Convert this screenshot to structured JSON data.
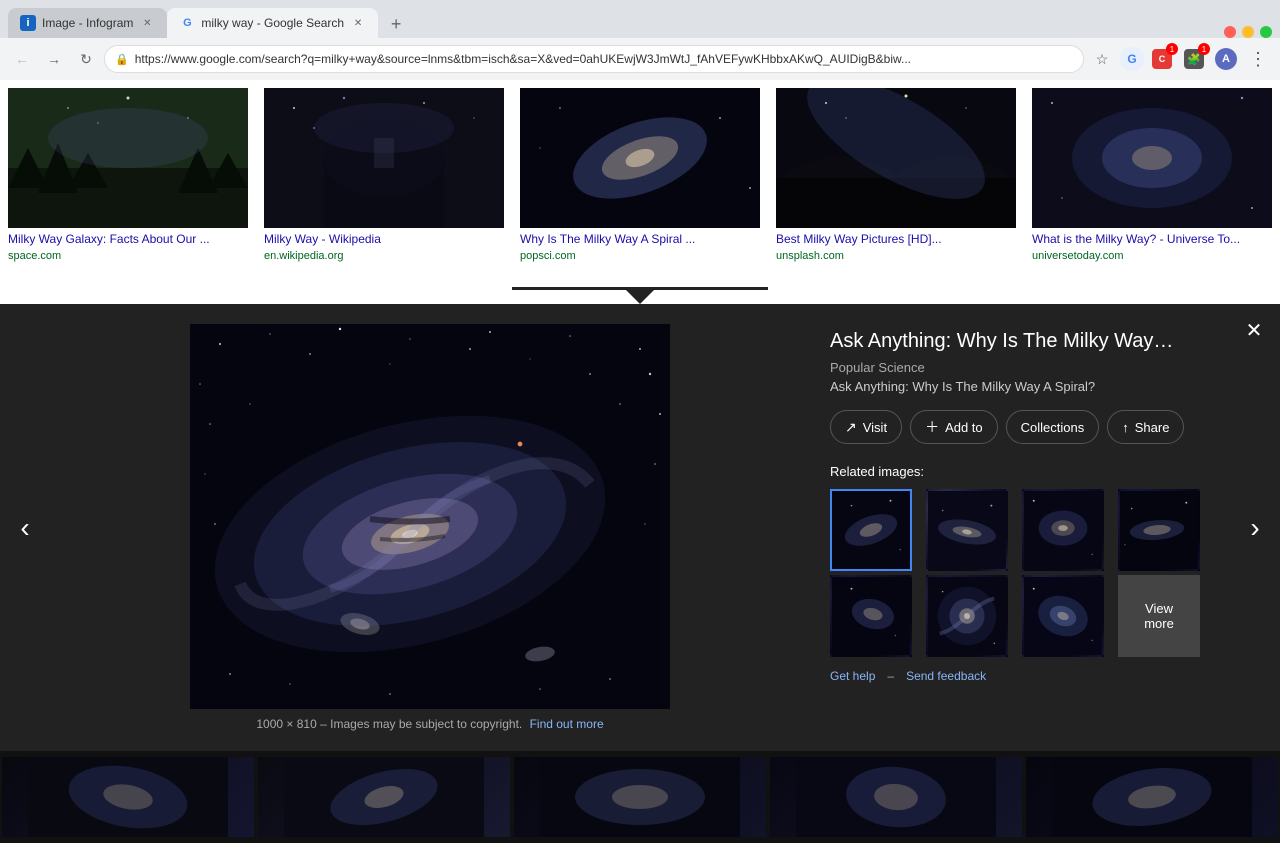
{
  "browser": {
    "tabs": [
      {
        "id": "tab-infogram",
        "favicon": "📊",
        "title": "Image - Infogram",
        "active": false
      },
      {
        "id": "tab-google",
        "favicon": "G",
        "title": "milky way - Google Search",
        "active": true
      }
    ],
    "new_tab_label": "+",
    "back_btn": "←",
    "forward_btn": "→",
    "reload_btn": "↻",
    "address": "https://www.google.com/search?q=milky+way&source=lnms&tbm=isch&sa=X&ved=0ahUKEwjW3JmWtJ_fAhVEFywKHbbxAKwQ_AUIDigB&biw...",
    "bookmark_icon": "☆",
    "extensions": [
      {
        "id": "ext-1",
        "label": "G",
        "color": "#4285f4"
      },
      {
        "id": "ext-2",
        "label": "C",
        "color": "#e53935"
      },
      {
        "id": "ext-3",
        "label": "🧩",
        "color": "#555",
        "badge": "1"
      },
      {
        "id": "ext-4",
        "label": "A",
        "color": "#5c6bc0"
      }
    ],
    "menu_btn": "⋮"
  },
  "search_results": {
    "images": [
      {
        "id": "img-1",
        "caption": "Milky Way Galaxy: Facts About Our ...",
        "source": "space.com",
        "bg": "#1a1a2e"
      },
      {
        "id": "img-2",
        "caption": "Milky Way - Wikipedia",
        "source": "en.wikipedia.org",
        "bg": "#0d0d1a"
      },
      {
        "id": "img-3",
        "caption": "Why Is The Milky Way A Spiral ...",
        "source": "popsci.com",
        "bg": "#0a0a18"
      },
      {
        "id": "img-4",
        "caption": "Best Milky Way Pictures [HD]...",
        "source": "unsplash.com",
        "bg": "#080818"
      },
      {
        "id": "img-5",
        "caption": "What is the Milky Way? - Universe To...",
        "source": "universetoday.com",
        "bg": "#0c0c20"
      }
    ]
  },
  "overlay": {
    "title": "Ask Anything: Why Is The Milky Way…",
    "source": "Popular Science",
    "description": "Ask Anything: Why Is The Milky Way A Spiral?",
    "actions": {
      "visit_label": "Visit",
      "add_label": "Add to",
      "collections_label": "Collections",
      "share_label": "Share"
    },
    "related_label": "Related images:",
    "image_meta_left": "1000 × 810",
    "image_meta_mid": "Images may be subject to copyright.",
    "image_meta_link": "Find out more",
    "view_more_label": "View",
    "view_more_label2": "more",
    "footer": {
      "help": "Get help",
      "separator": "–",
      "feedback": "Send feedback"
    }
  },
  "bottom_strip": {
    "items": [
      {
        "id": "b1",
        "bg": "#111"
      },
      {
        "id": "b2",
        "bg": "#111"
      },
      {
        "id": "b3",
        "bg": "#111"
      },
      {
        "id": "b4",
        "bg": "#111"
      },
      {
        "id": "b5",
        "bg": "#111"
      }
    ]
  }
}
